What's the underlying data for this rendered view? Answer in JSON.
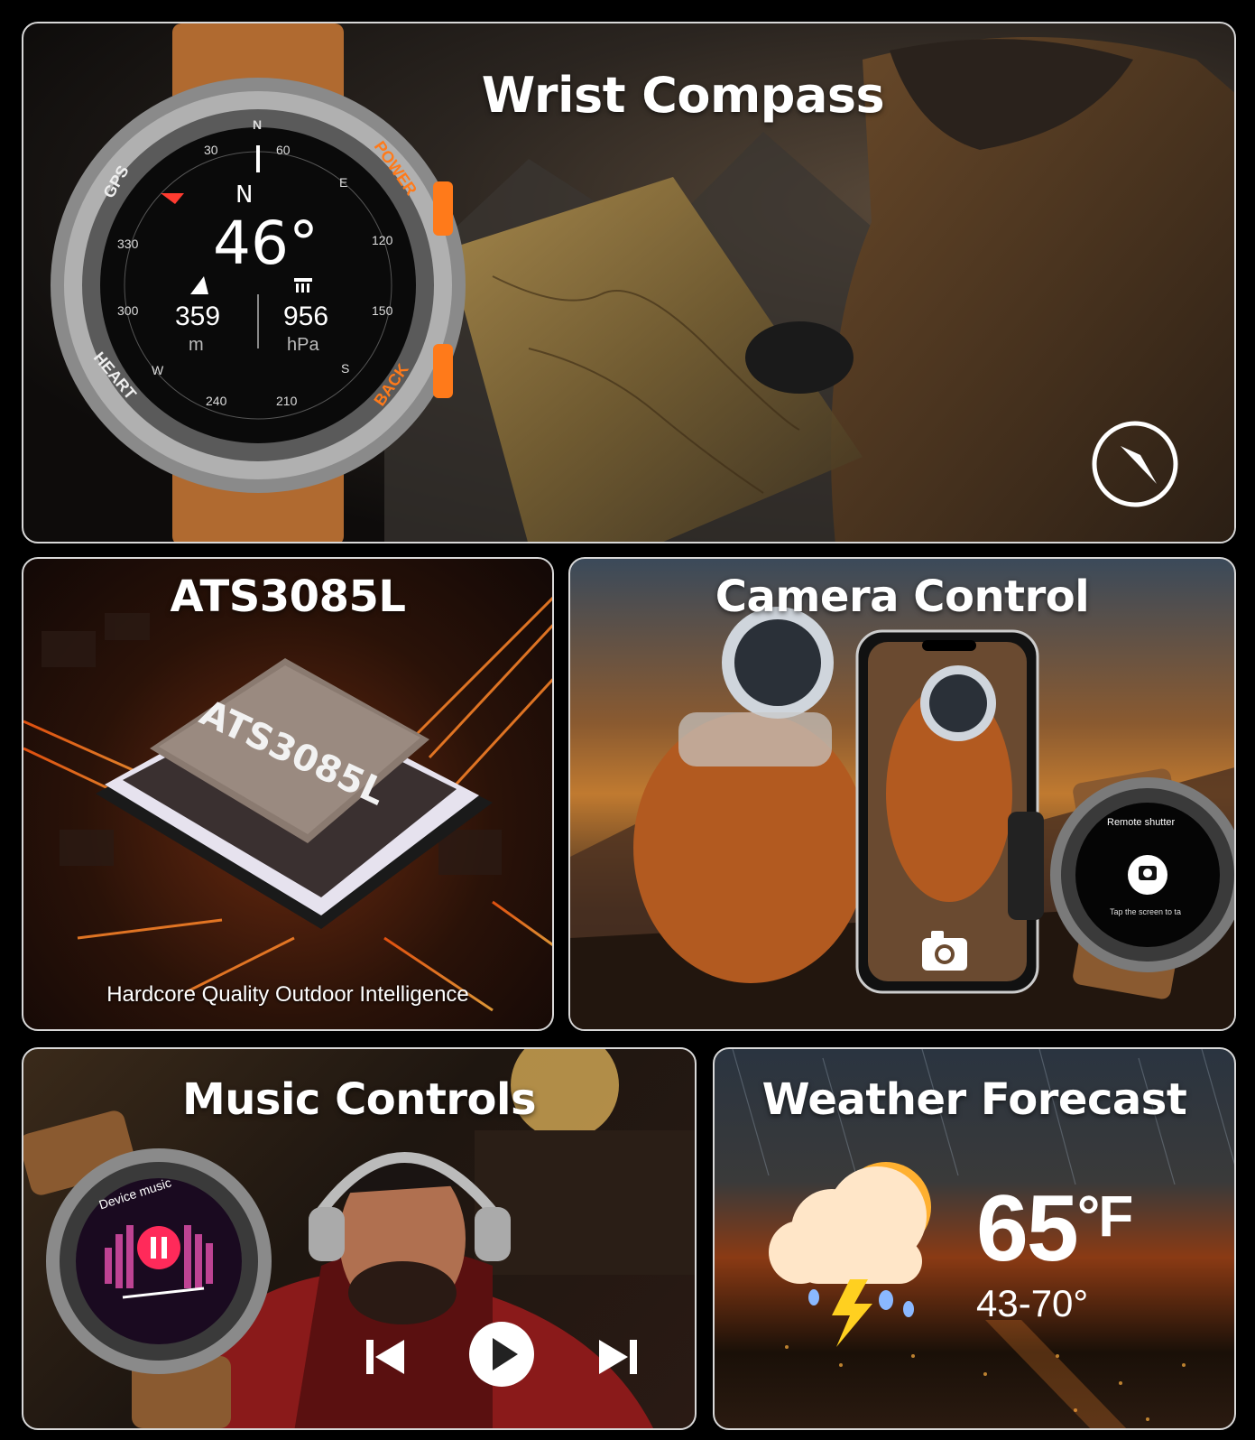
{
  "compass": {
    "title": "Wrist Compass",
    "heading": "N",
    "degrees": "46°",
    "altitude": "359",
    "altitude_unit": "m",
    "pressure": "956",
    "pressure_unit": "hPa",
    "bezel_labels": [
      "GPS",
      "POWER",
      "HEART",
      "BACK"
    ],
    "ring_labels": [
      "30",
      "60",
      "E",
      "120",
      "150",
      "S",
      "210",
      "240",
      "W",
      "300",
      "330",
      "N"
    ],
    "accent_color": "#ff7a1a"
  },
  "chip": {
    "title": "ATS3085L",
    "chip_label": "ATS3085L",
    "subtitle": "Hardcore Quality Outdoor Intelligence"
  },
  "camera": {
    "title": "Camera Control",
    "watch_header": "Remote shutter",
    "watch_hint": "Tap the screen to ta"
  },
  "music": {
    "title": "Music Controls",
    "watch_header": "Device music"
  },
  "weather": {
    "title": "Weather Forecast",
    "temperature": "65",
    "unit": "°F",
    "range": "43-70°"
  }
}
